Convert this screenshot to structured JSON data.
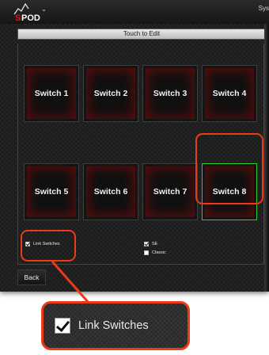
{
  "header": {
    "system_label": "Sys",
    "edit_bar_label": "Touch to Edit"
  },
  "switches": [
    {
      "label": "Switch 1"
    },
    {
      "label": "Switch 2"
    },
    {
      "label": "Switch 3"
    },
    {
      "label": "Switch 4"
    },
    {
      "label": "Switch 5"
    },
    {
      "label": "Switch 6"
    },
    {
      "label": "Switch 7"
    },
    {
      "label": "Switch 8"
    }
  ],
  "options": {
    "link_switches": {
      "label": "Link Switches",
      "checked": true
    },
    "se": {
      "label": "SE",
      "checked": true
    },
    "classic": {
      "label": "Classic",
      "checked": false
    }
  },
  "footer": {
    "back_label": "Back"
  },
  "callout": {
    "zoom_label": "Link Switches",
    "zoom_checked": true
  },
  "colors": {
    "highlight": "#ee3a16",
    "active_outline": "#2ecc2e",
    "tile_glow": "#960a0a"
  }
}
